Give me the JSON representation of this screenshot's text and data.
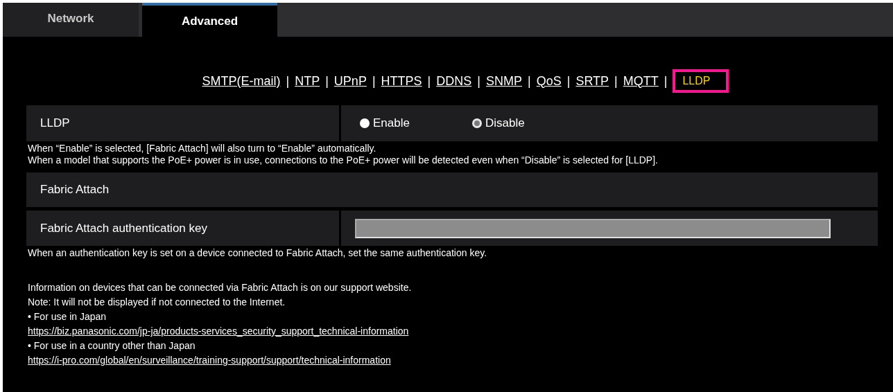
{
  "tabs": [
    {
      "label": "Network",
      "selected": false
    },
    {
      "label": "Advanced",
      "selected": true
    }
  ],
  "nav_links": [
    {
      "label": "SMTP(E-mail)",
      "selected": false
    },
    {
      "label": "NTP",
      "selected": false
    },
    {
      "label": "UPnP",
      "selected": false
    },
    {
      "label": "HTTPS",
      "selected": false
    },
    {
      "label": "DDNS",
      "selected": false
    },
    {
      "label": "SNMP",
      "selected": false
    },
    {
      "label": "QoS",
      "selected": false
    },
    {
      "label": "SRTP",
      "selected": false
    },
    {
      "label": "MQTT",
      "selected": false
    },
    {
      "label": "LLDP",
      "selected": true
    }
  ],
  "separator": "|",
  "sections": [
    {
      "kind": "radio",
      "label": "LLDP",
      "options": [
        {
          "label": "Enable",
          "selected": false
        },
        {
          "label": "Disable",
          "selected": true
        }
      ],
      "notes": [
        "When “Enable” is selected, [Fabric Attach] will also turn to “Enable” automatically.",
        "When a model that supports the PoE+ power is in use, connections to the PoE+ power will be detected even when “Disable” is selected for [LLDP]."
      ]
    },
    {
      "kind": "header",
      "label": "Fabric Attach"
    },
    {
      "kind": "text_field",
      "label": "Fabric Attach authentication key",
      "disabled": true,
      "notes": [
        "When an authentication key is set on a device connected to Fabric Attach, set the same authentication key."
      ]
    }
  ],
  "info": [
    {
      "kind": "text",
      "text": "Information on devices that can be connected via Fabric Attach is on our support website."
    },
    {
      "kind": "text",
      "text": "Note: It will not be displayed if not connected to the Internet."
    },
    {
      "kind": "text",
      "text": "• For use in Japan"
    },
    {
      "kind": "link",
      "text": "https://biz.panasonic.com/jp-ja/products-services_security_support_technical-information"
    },
    {
      "kind": "text",
      "text": "• For use in a country other than Japan"
    },
    {
      "kind": "link",
      "text": "https://i-pro.com/global/en/surveillance/training-support/support/technical-information"
    }
  ]
}
